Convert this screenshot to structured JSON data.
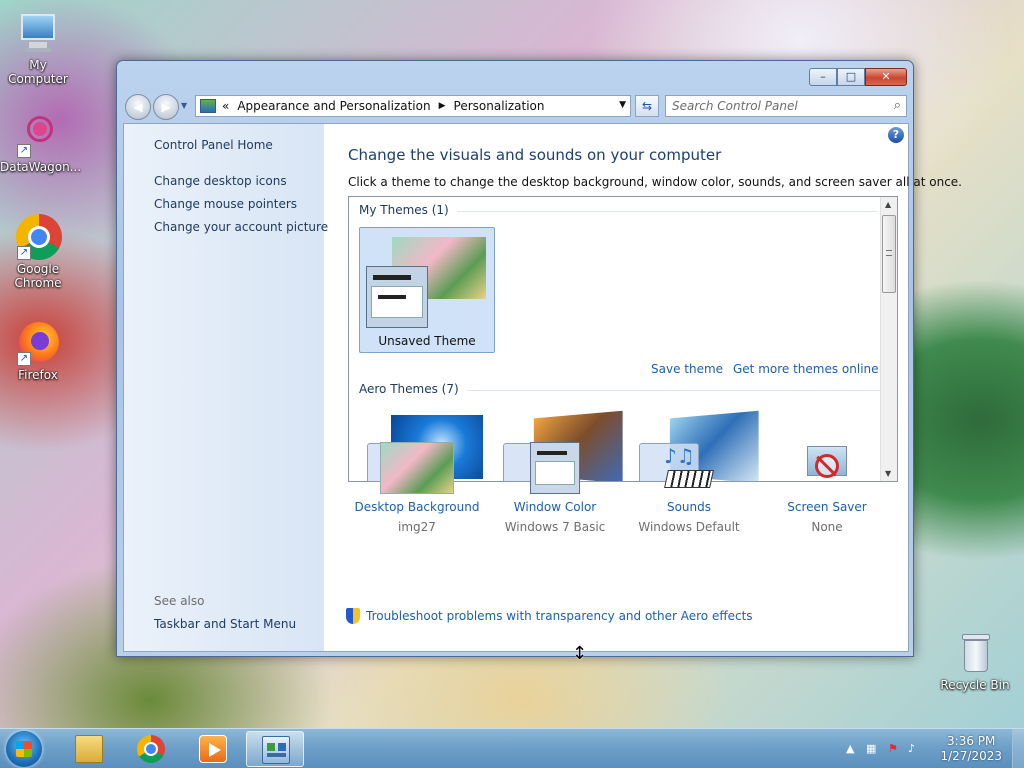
{
  "desktop": {
    "icons": [
      {
        "label": "My Computer"
      },
      {
        "label": "DataWagon..."
      },
      {
        "label": "Google Chrome"
      },
      {
        "label": "Firefox"
      },
      {
        "label": "Recycle Bin"
      }
    ]
  },
  "window": {
    "buttons": {
      "minimize": "–",
      "maximize": "□",
      "close": "✕"
    },
    "address": {
      "prefix": "«",
      "crumbs": [
        "Appearance and Personalization",
        "Personalization"
      ]
    },
    "search": {
      "placeholder": "Search Control Panel"
    },
    "sidebar": {
      "links": [
        "Control Panel Home",
        "Change desktop icons",
        "Change mouse pointers",
        "Change your account picture"
      ],
      "see_also": "See also",
      "see_also_links": [
        "Taskbar and Start Menu"
      ]
    },
    "main": {
      "title": "Change the visuals and sounds on your computer",
      "description": "Click a theme to change the desktop background, window color, sounds, and screen saver all at once.",
      "my_themes": {
        "heading": "My Themes (1)",
        "themes": [
          {
            "name": "Unsaved Theme"
          }
        ],
        "links": [
          "Save theme",
          "Get more themes online"
        ]
      },
      "aero_themes": {
        "heading": "Aero Themes (7)"
      },
      "settings": [
        {
          "label": "Desktop Background",
          "value": "img27"
        },
        {
          "label": "Window Color",
          "value": "Windows 7 Basic"
        },
        {
          "label": "Sounds",
          "value": "Windows Default"
        },
        {
          "label": "Screen Saver",
          "value": "None"
        }
      ],
      "troubleshoot": "Troubleshoot problems with transparency and other Aero effects"
    }
  },
  "taskbar": {
    "clock": {
      "time": "3:36 PM",
      "date": "1/27/2023"
    }
  },
  "colors": {
    "link": "#1c5fb0",
    "heading": "#1e3f6e",
    "taskbar": "#6ea0c8"
  }
}
